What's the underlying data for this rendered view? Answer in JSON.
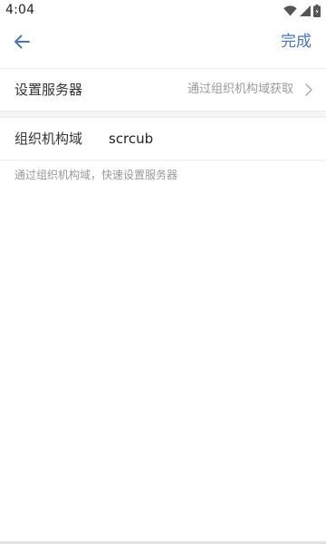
{
  "status_bar": {
    "time": "4:04",
    "icons": [
      "wifi-icon",
      "signal-icon",
      "battery-icon"
    ]
  },
  "app_bar": {
    "back_icon": "arrow-left-icon",
    "done_label": "完成"
  },
  "server_row": {
    "label": "设置服务器",
    "value": "通过组织机构域获取",
    "chevron_icon": "chevron-right-icon"
  },
  "domain_row": {
    "label": "组织机构域",
    "value": "scrcub"
  },
  "hint": "通过组织机构域，快速设置服务器",
  "colors": {
    "accent": "#4a76b5",
    "divider": "#ededed",
    "hint_text": "#9a9a9a"
  }
}
